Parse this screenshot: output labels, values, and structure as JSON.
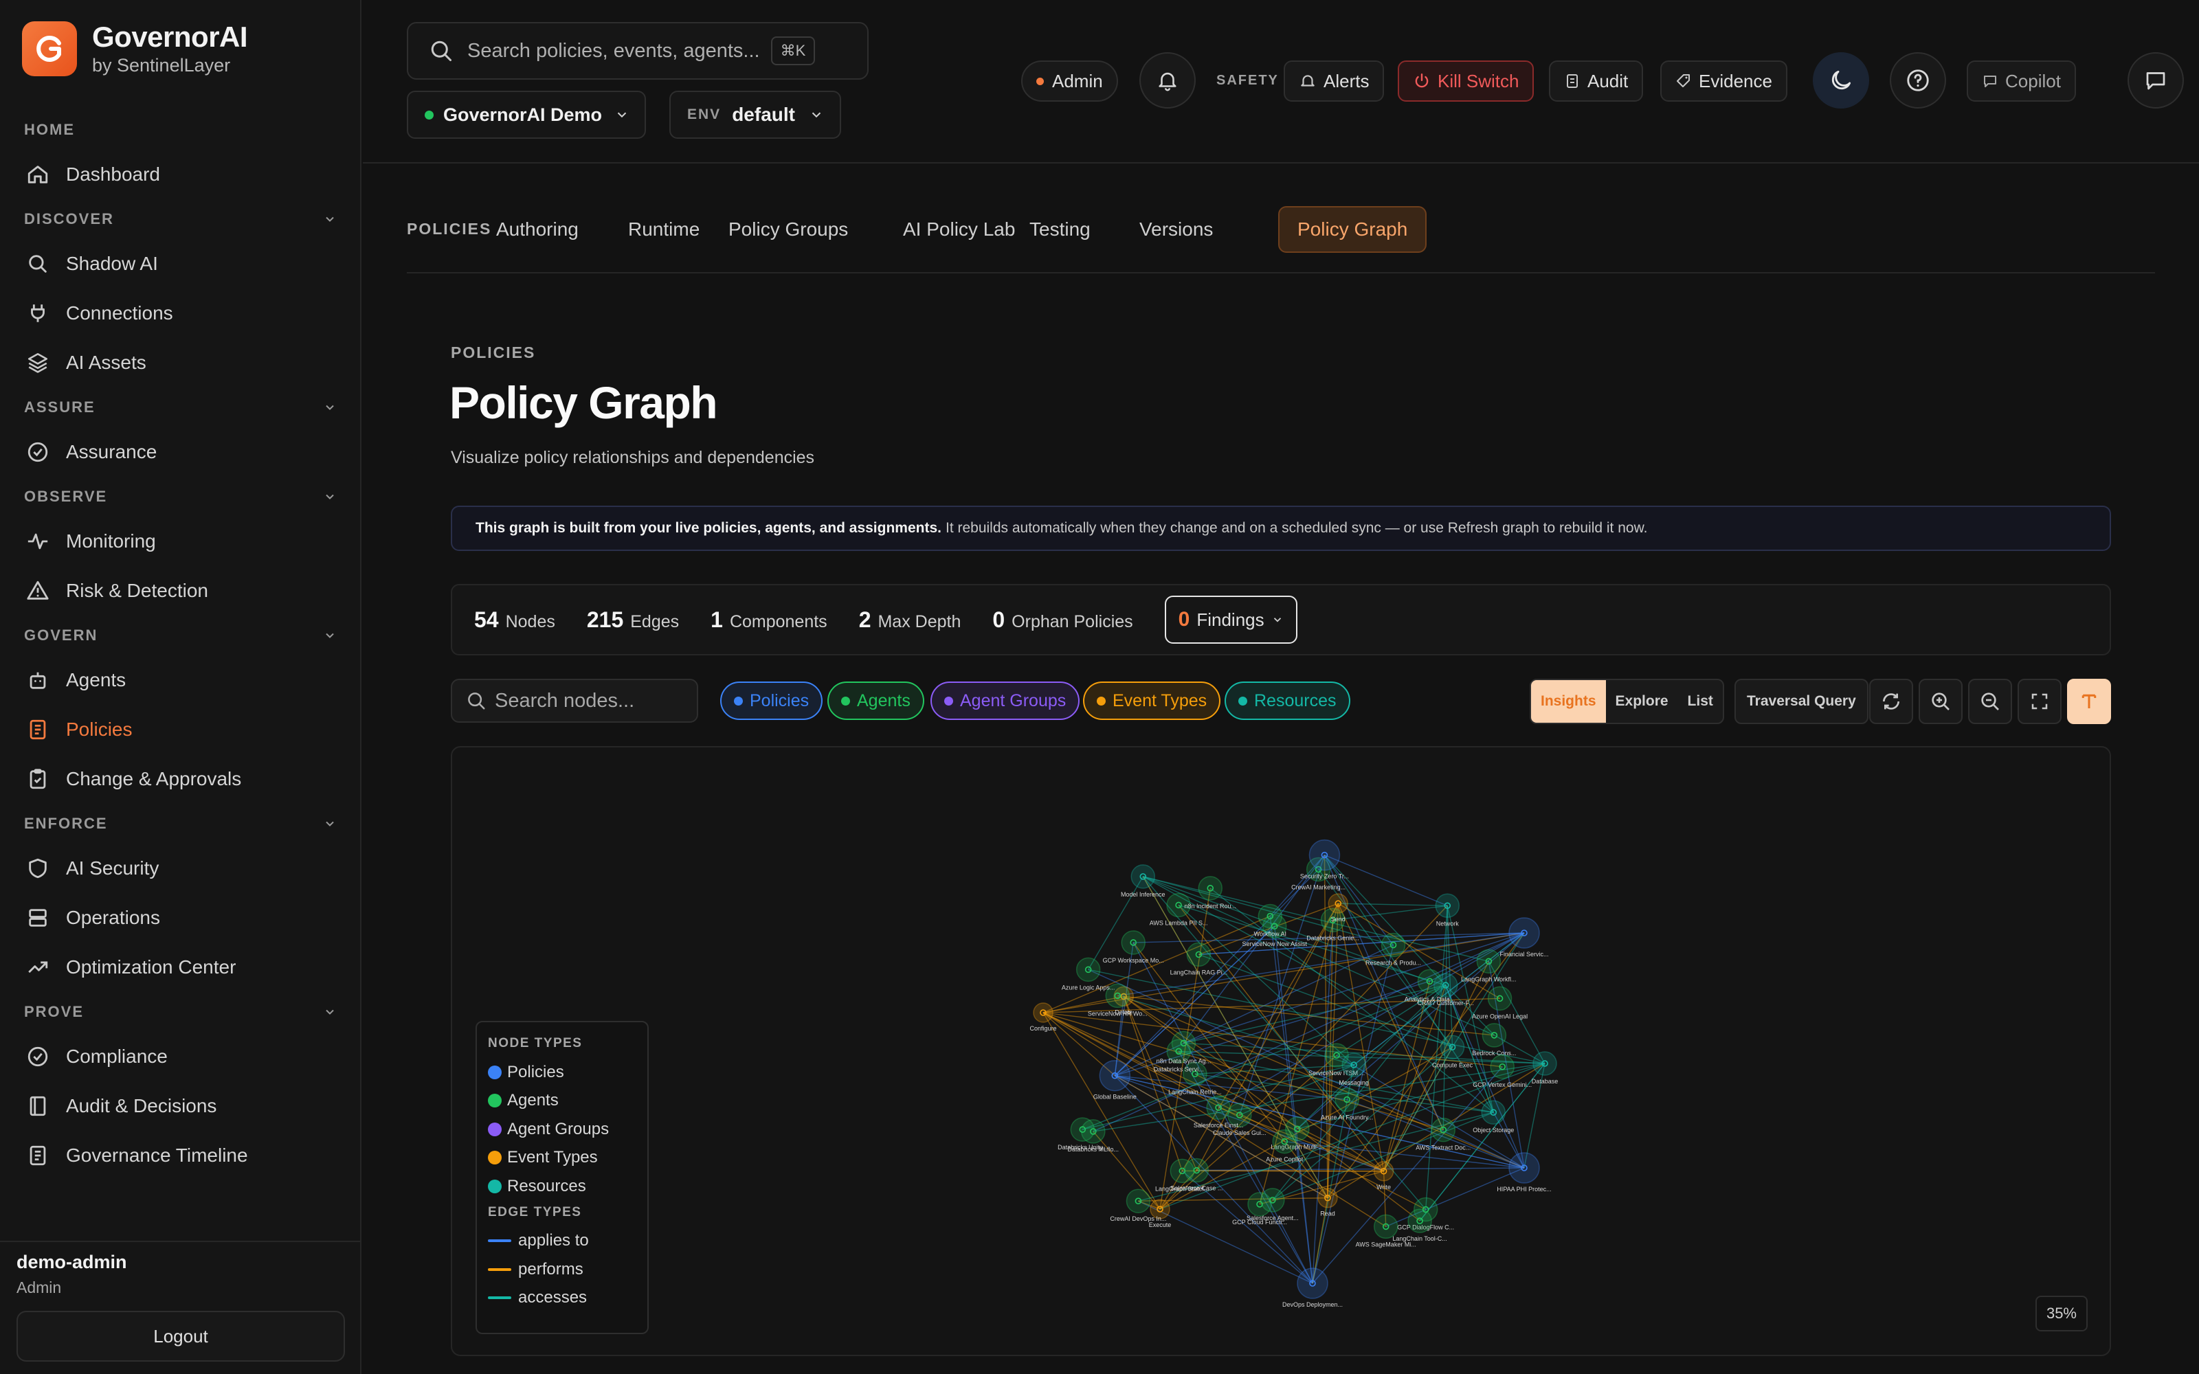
{
  "brand": {
    "name": "GovernorAI",
    "subtitle": "by SentinelLayer",
    "accent": "#f47a3e"
  },
  "sidebar": {
    "sections": [
      {
        "label": "HOME",
        "items": [
          {
            "label": "Dashboard",
            "icon": "home-icon"
          }
        ]
      },
      {
        "label": "DISCOVER",
        "items": [
          {
            "label": "Shadow AI",
            "icon": "search-icon"
          },
          {
            "label": "Connections",
            "icon": "plug-icon"
          },
          {
            "label": "AI Assets",
            "icon": "layers-icon"
          }
        ]
      },
      {
        "label": "ASSURE",
        "items": [
          {
            "label": "Assurance",
            "icon": "check-circle-icon"
          }
        ]
      },
      {
        "label": "OBSERVE",
        "items": [
          {
            "label": "Monitoring",
            "icon": "pulse-icon"
          },
          {
            "label": "Risk & Detection",
            "icon": "warning-icon"
          }
        ]
      },
      {
        "label": "GOVERN",
        "items": [
          {
            "label": "Agents",
            "icon": "bot-icon"
          },
          {
            "label": "Policies",
            "icon": "document-icon",
            "active": true
          },
          {
            "label": "Change & Approvals",
            "icon": "clipboard-check-icon"
          }
        ]
      },
      {
        "label": "ENFORCE",
        "items": [
          {
            "label": "AI Security",
            "icon": "shield-icon"
          },
          {
            "label": "Operations",
            "icon": "server-icon"
          },
          {
            "label": "Optimization Center",
            "icon": "trending-up-icon"
          }
        ]
      },
      {
        "label": "PROVE",
        "items": [
          {
            "label": "Compliance",
            "icon": "check-circle-icon"
          },
          {
            "label": "Audit & Decisions",
            "icon": "book-icon"
          },
          {
            "label": "Governance Timeline",
            "icon": "document-icon"
          }
        ]
      }
    ],
    "user": {
      "name": "demo-admin",
      "role": "Admin"
    },
    "logout_label": "Logout"
  },
  "header": {
    "search_placeholder": "Search policies, events, agents...",
    "search_shortcut": "⌘K",
    "workspace": "GovernorAI Demo",
    "env_label": "ENV",
    "env_value": "default",
    "role_badge": "Admin",
    "safety_label": "SAFETY",
    "alerts_label": "Alerts",
    "kill_switch_label": "Kill Switch",
    "audit_label": "Audit",
    "evidence_label": "Evidence",
    "copilot_label": "Copilot"
  },
  "tabs": {
    "section_label": "POLICIES",
    "items": [
      "Authoring",
      "Runtime",
      "Policy Groups",
      "AI Policy Lab",
      "Testing",
      "Versions",
      "Policy Graph"
    ],
    "active": "Policy Graph"
  },
  "page": {
    "breadcrumb": "POLICIES",
    "title": "Policy Graph",
    "subtitle": "Visualize policy relationships and dependencies",
    "banner_bold": "This graph is built from your live policies, agents, and assignments.",
    "banner_text": "It rebuilds automatically when they change and on a scheduled sync — or use Refresh graph to rebuild it now."
  },
  "stats": [
    {
      "value": "54",
      "label": "Nodes"
    },
    {
      "value": "215",
      "label": "Edges"
    },
    {
      "value": "1",
      "label": "Components"
    },
    {
      "value": "2",
      "label": "Max Depth"
    },
    {
      "value": "0",
      "label": "Orphan Policies"
    }
  ],
  "findings": {
    "value": "0",
    "label": "Findings"
  },
  "toolbar": {
    "node_search_placeholder": "Search nodes...",
    "filters": [
      {
        "label": "Policies",
        "color": "#3b82f6"
      },
      {
        "label": "Agents",
        "color": "#22c55e"
      },
      {
        "label": "Agent Groups",
        "color": "#8b5cf6"
      },
      {
        "label": "Event Types",
        "color": "#f59e0b"
      },
      {
        "label": "Resources",
        "color": "#14b8a6"
      }
    ],
    "view_modes": [
      "Insights",
      "Explore",
      "List"
    ],
    "active_view": "Insights",
    "traversal_label": "Traversal Query"
  },
  "legend": {
    "node_types_label": "NODE TYPES",
    "node_types": [
      {
        "label": "Policies",
        "color": "#3b82f6"
      },
      {
        "label": "Agents",
        "color": "#22c55e"
      },
      {
        "label": "Agent Groups",
        "color": "#8b5cf6"
      },
      {
        "label": "Event Types",
        "color": "#f59e0b"
      },
      {
        "label": "Resources",
        "color": "#14b8a6"
      }
    ],
    "edge_types_label": "EDGE TYPES",
    "edge_types": [
      {
        "label": "applies to",
        "color": "#3b82f6"
      },
      {
        "label": "performs",
        "color": "#f59e0b"
      },
      {
        "label": "accesses",
        "color": "#14b8a6"
      }
    ]
  },
  "graph": {
    "zoom": "35%",
    "nodes": [
      {
        "label": "ServiceNow ITSM ...",
        "type": "agent"
      },
      {
        "label": "Messaging",
        "type": "resource"
      },
      {
        "label": "Azure AI Foundry...",
        "type": "agent"
      },
      {
        "label": "Financial Servic...",
        "type": "policy"
      },
      {
        "label": "LangGraph Multi-...",
        "type": "agent"
      },
      {
        "label": "Azure Copilot",
        "type": "agent"
      },
      {
        "label": "Claude Sales Gui...",
        "type": "agent"
      },
      {
        "label": "Salesforce Einst...",
        "type": "agent"
      },
      {
        "label": "LangChain Retrie...",
        "type": "agent"
      },
      {
        "label": "Databricks Servi...",
        "type": "agent"
      },
      {
        "label": "n8n Data Sync Ag...",
        "type": "agent"
      },
      {
        "label": "LangChain RAG Pi...",
        "type": "agent"
      },
      {
        "label": "Configure",
        "type": "event"
      },
      {
        "label": "ServiceNow Now Assist",
        "type": "agent"
      },
      {
        "label": "Workflow AI",
        "type": "agent"
      },
      {
        "label": "Databricks Genie...",
        "type": "agent"
      },
      {
        "label": "Send",
        "type": "event"
      },
      {
        "label": "Research & Produ...",
        "type": "agent"
      },
      {
        "label": "Analytics & Data...",
        "type": "agent"
      },
      {
        "label": "CRM / Customer-F...",
        "type": "resource"
      },
      {
        "label": "Compute Exec",
        "type": "resource"
      },
      {
        "label": "Database",
        "type": "resource"
      },
      {
        "label": "AWS Textract Doc...",
        "type": "agent"
      },
      {
        "label": "Write",
        "type": "event"
      },
      {
        "label": "Read",
        "type": "event"
      },
      {
        "label": "GCP Cloud Functi...",
        "type": "agent"
      },
      {
        "label": "Salesforce Agent...",
        "type": "agent"
      },
      {
        "label": "Salesforce Case ...",
        "type": "agent"
      },
      {
        "label": "LangGraph Statef...",
        "type": "agent"
      },
      {
        "label": "Global Baseline",
        "type": "policy"
      },
      {
        "label": "Delete",
        "type": "event"
      },
      {
        "label": "ServiceNow HR Wo...",
        "type": "agent"
      },
      {
        "label": "GCP Workspace Mo...",
        "type": "agent"
      },
      {
        "label": "AWS Lambda PII S...",
        "type": "agent"
      },
      {
        "label": "n8n Incident Rou...",
        "type": "agent"
      },
      {
        "label": "CrewAI Marketing...",
        "type": "agent"
      },
      {
        "label": "Security Zero Tr...",
        "type": "policy"
      },
      {
        "label": "Network",
        "type": "resource"
      },
      {
        "label": "LangGraph Workfl...",
        "type": "agent"
      },
      {
        "label": "Azure OpenAI Legal",
        "type": "agent"
      },
      {
        "label": "Bedrock Cons...",
        "type": "agent"
      },
      {
        "label": "GCP Vertex Gemini...",
        "type": "agent"
      },
      {
        "label": "Object Storage",
        "type": "resource"
      },
      {
        "label": "GCP DialogFlow C...",
        "type": "agent"
      },
      {
        "label": "LangChain Tool-C...",
        "type": "agent"
      },
      {
        "label": "AWS SageMaker Mi...",
        "type": "agent"
      },
      {
        "label": "HIPAA PHI Protec...",
        "type": "policy"
      },
      {
        "label": "Execute",
        "type": "event"
      },
      {
        "label": "CrewAI DevOps In...",
        "type": "agent"
      },
      {
        "label": "Databricks MLflo...",
        "type": "agent"
      },
      {
        "label": "Databricks Unity...",
        "type": "agent"
      },
      {
        "label": "Azure Logic Apps...",
        "type": "agent"
      },
      {
        "label": "DevOps Deploymen...",
        "type": "policy"
      },
      {
        "label": "Model Inference",
        "type": "resource"
      }
    ]
  }
}
